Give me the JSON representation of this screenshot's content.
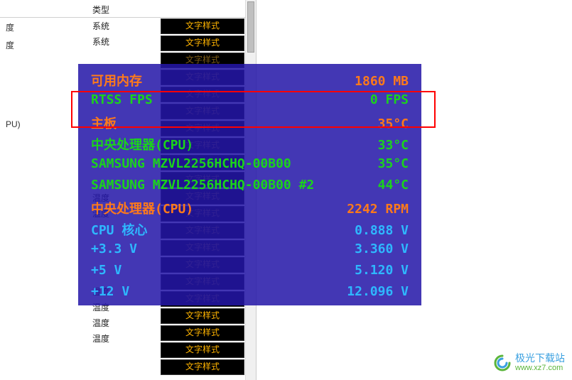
{
  "header": {
    "type_col": "类型"
  },
  "side_items": [
    {
      "label": "度"
    },
    {
      "label": "度"
    },
    {
      "label": ""
    },
    {
      "label": ""
    },
    {
      "label": ""
    },
    {
      "label": ""
    },
    {
      "label": ""
    },
    {
      "label": ""
    },
    {
      "label": ""
    },
    {
      "label": ""
    },
    {
      "label": ""
    },
    {
      "label": ""
    },
    {
      "label": ""
    },
    {
      "label": "PU)"
    },
    {
      "label": ""
    },
    {
      "label": ""
    },
    {
      "label": ""
    },
    {
      "label": ""
    },
    {
      "label": ""
    },
    {
      "label": ""
    },
    {
      "label": ""
    }
  ],
  "type_items": [
    {
      "t": "系统",
      "dim": false
    },
    {
      "t": "系统",
      "dim": false
    },
    {
      "t": "",
      "dim": true
    },
    {
      "t": "",
      "dim": true
    },
    {
      "t": "",
      "dim": true
    },
    {
      "t": "",
      "dim": true
    },
    {
      "t": "",
      "dim": true
    },
    {
      "t": "",
      "dim": true
    },
    {
      "t": "",
      "dim": true
    },
    {
      "t": "",
      "dim": true
    },
    {
      "t": "",
      "dim": true
    },
    {
      "t": "温度",
      "dim": true
    },
    {
      "t": "温度",
      "dim": true
    },
    {
      "t": "",
      "dim": true
    },
    {
      "t": "",
      "dim": true
    },
    {
      "t": "",
      "dim": true
    },
    {
      "t": "",
      "dim": true
    },
    {
      "t": "温度",
      "dim": false
    },
    {
      "t": "温度",
      "dim": false
    },
    {
      "t": "温度",
      "dim": false
    },
    {
      "t": "温度",
      "dim": false
    }
  ],
  "style_label": "文字样式",
  "osd_rows": [
    {
      "label": "可用内存",
      "value": "1860",
      "unit": "MB",
      "lcls": "orange",
      "vcls": "orange"
    },
    {
      "label": "RTSS FPS",
      "value": "0",
      "unit": "FPS",
      "lcls": "green",
      "vcls": "green"
    },
    {
      "label": "主板",
      "value": "35°C",
      "unit": "",
      "lcls": "orange",
      "vcls": "orange"
    },
    {
      "label": "中央处理器(CPU)",
      "value": "33°C",
      "unit": "",
      "lcls": "green",
      "vcls": "green"
    },
    {
      "label": "SAMSUNG MZVL2256HCHQ-00B00",
      "value": "35°C",
      "unit": "",
      "lcls": "green",
      "vcls": "green"
    },
    {
      "label": "SAMSUNG MZVL2256HCHQ-00B00 #2",
      "value": "44°C",
      "unit": "",
      "lcls": "green",
      "vcls": "green"
    },
    {
      "label": "中央处理器(CPU)",
      "value": "2242",
      "unit": "RPM",
      "lcls": "orange",
      "vcls": "orange"
    },
    {
      "label": "CPU 核心",
      "value": "0.888",
      "unit": "V",
      "lcls": "blue",
      "vcls": "blue"
    },
    {
      "label": "+3.3 V",
      "value": "3.360",
      "unit": "V",
      "lcls": "blue",
      "vcls": "blue"
    },
    {
      "label": "+5 V",
      "value": "5.120",
      "unit": "V",
      "lcls": "blue",
      "vcls": "blue"
    },
    {
      "label": "+12 V",
      "value": "12.096",
      "unit": "V",
      "lcls": "blue",
      "vcls": "blue"
    }
  ],
  "watermark": {
    "site": "极光下载站",
    "url": "www.xz7.com"
  }
}
